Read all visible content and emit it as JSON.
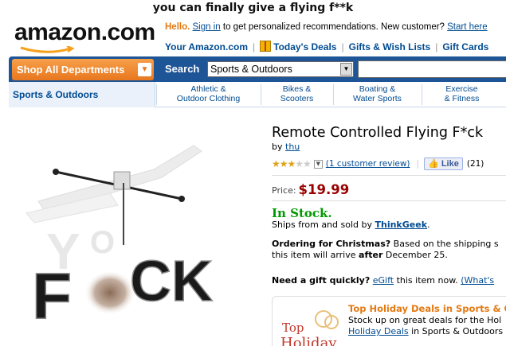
{
  "caption": "you can finally give a flying f**k",
  "header": {
    "logo": "amazon.com",
    "hello": "Hello.",
    "sign_in": "Sign in",
    "hello_rest": " to get personalized recommendations. New customer? ",
    "start_here": "Start here",
    "links": [
      "Your Amazon.com",
      "Today's Deals",
      "Gifts & Wish Lists",
      "Gift Cards"
    ]
  },
  "nav": {
    "shop_all": "Shop All Departments",
    "search_label": "Search",
    "search_category": "Sports & Outdoors",
    "search_value": ""
  },
  "subnav": {
    "current": "Sports & Outdoors",
    "items": [
      {
        "line1": "Athletic &",
        "line2": "Outdoor Clothing"
      },
      {
        "line1": "Bikes &",
        "line2": "Scooters"
      },
      {
        "line1": "Boating &",
        "line2": "Water Sports"
      },
      {
        "line1": "Exercise",
        "line2": "& Fitness"
      }
    ]
  },
  "product": {
    "title": "Remote Controlled Flying F*ck",
    "by": "by ",
    "author": "thu",
    "rating": 3,
    "rating_max": 5,
    "review_link": "(1 customer review)",
    "like_label": "Like",
    "like_count": "(21)",
    "price_label": "Price:",
    "price": "$19.99",
    "stock": "In Stock.",
    "ships_text": "Ships from and sold by ",
    "seller": "ThinkGeek",
    "ships_end": ".",
    "ordering_bold": "Ordering for Christmas?",
    "ordering_text": " Based on the shipping s",
    "ordering_line2_a": "this item will arrive ",
    "ordering_after": "after",
    "ordering_line2_b": " December 25.",
    "gift_bold": "Need a gift quickly?",
    "gift_link": "eGift",
    "gift_text": " this item now. ",
    "whats": "(What's"
  },
  "image": {
    "letters_left": "F",
    "letters_right": "CK"
  },
  "promo": {
    "title": "Top Holiday Deals in Sports & O",
    "line1": "Stock up on great deals for the Hol",
    "link": "Holiday Deals",
    "line2_rest": " in Sports & Outdoors",
    "badge_line1": "Top",
    "badge_line2": "Holiday"
  },
  "colors": {
    "brand_blue": "#1e5596",
    "shop_orange": "#e8771e",
    "link": "#004b91",
    "price": "#990000",
    "stock": "#009900"
  }
}
